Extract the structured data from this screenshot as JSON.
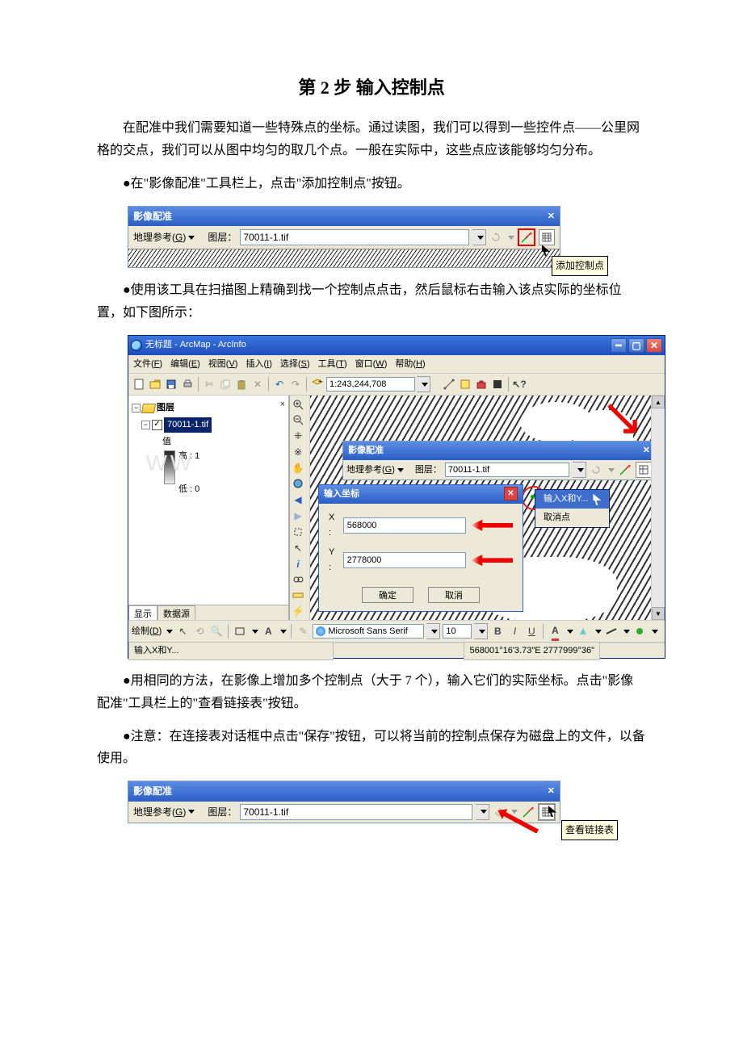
{
  "title": "第 2 步 输入控制点",
  "para1": "在配准中我们需要知道一些特殊点的坐标。通过读图，我们可以得到一些控件点——公里网格的交点，我们可以从图中均匀的取几个点。一般在实际中，这些点应该能够均匀分布。",
  "bullet1": "●在\"影像配准\"工具栏上，点击\"添加控制点\"按钮。",
  "para2": "●使用该工具在扫描图上精确到找一个控制点点击，然后鼠标右击输入该点实际的坐标位置，如下图所示：",
  "para3": "●用相同的方法，在影像上增加多个控制点（大于 7 个），输入它们的实际坐标。点击\"影像配准\"工具栏上的\"查看链接表\"按钮。",
  "para4": "●注意：在连接表对话框中点击\"保存\"按钮，可以将当前的控制点保存为磁盘上的文件，以备使用。",
  "georef": {
    "title": "影像配准",
    "dd_label_pre": "地理参考(",
    "dd_hotkey": "G",
    "dd_label_post": ")",
    "layer_label": "图层：",
    "layer_value": "70011-1.tif",
    "tooltip_add": "添加控制点",
    "tooltip_viewlinks": "查看链接表"
  },
  "arcmap": {
    "window_title": "无标题 - ArcMap - ArcInfo",
    "menus": [
      {
        "pre": "文件(",
        "hot": "F",
        "post": ")"
      },
      {
        "pre": "编辑(",
        "hot": "E",
        "post": ")"
      },
      {
        "pre": "视图(",
        "hot": "V",
        "post": ")"
      },
      {
        "pre": "插入(",
        "hot": "I",
        "post": ")"
      },
      {
        "pre": "选择(",
        "hot": "S",
        "post": ")"
      },
      {
        "pre": "工具(",
        "hot": "T",
        "post": ")"
      },
      {
        "pre": "窗口(",
        "hot": "W",
        "post": ")"
      },
      {
        "pre": "帮助(",
        "hot": "H",
        "post": ")"
      }
    ],
    "scale": "1:243,244,708",
    "toc": {
      "root": "图层",
      "layer": "70011-1.tif",
      "val_label": "值",
      "high": "高 : 1",
      "low": "低 : 0",
      "tab_display": "显示",
      "tab_source": "数据源"
    },
    "input_dlg": {
      "title": "输入坐标",
      "xlabel": "X :",
      "ylabel": "Y :",
      "x": "568000",
      "y": "2778000",
      "ok": "确定",
      "cancel": "取消"
    },
    "context_menu": {
      "item1": "输入X和Y...",
      "item2": "取消点"
    },
    "draw_label_pre": "绘制(",
    "draw_hot": "D",
    "draw_label_post": ")",
    "font_name": "Microsoft Sans Serif",
    "font_size": "10",
    "status_left": "输入X和Y...",
    "status_coord": "568001°16'3.73\"E  2777999°36\""
  }
}
